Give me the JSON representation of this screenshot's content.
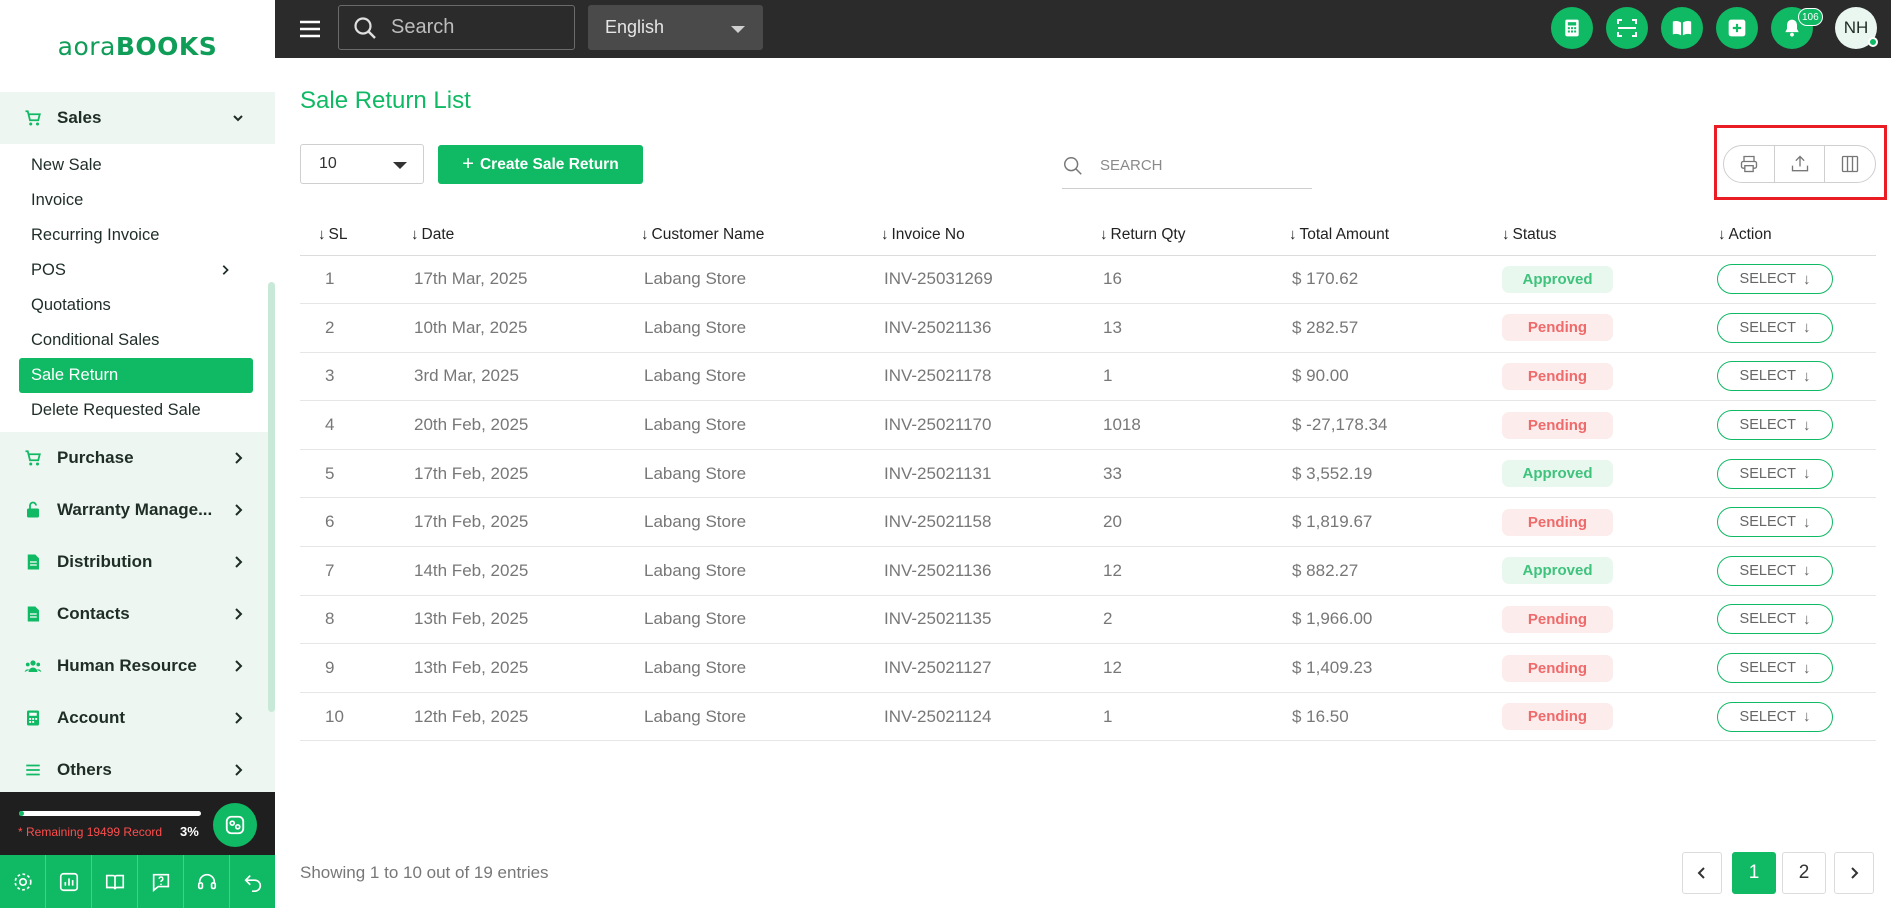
{
  "brand": {
    "logo_light": "aora",
    "logo_bold": "BOOKS"
  },
  "topbar": {
    "search_placeholder": "Search",
    "language": "English",
    "notification_count": "106",
    "avatar_initials": "NH"
  },
  "sidebar": {
    "sales": {
      "label": "Sales",
      "items": [
        "New Sale",
        "Invoice",
        "Recurring Invoice",
        "POS",
        "Quotations",
        "Conditional Sales",
        "Sale Return",
        "Delete Requested Sale"
      ],
      "active_item": "Sale Return"
    },
    "groups": [
      "Purchase",
      "Warranty Manage...",
      "Distribution",
      "Contacts",
      "Human Resource",
      "Account",
      "Others"
    ],
    "usage": {
      "text": "* Remaining 19499 Record",
      "percent": "3%",
      "fill_fraction": 0.03
    }
  },
  "page": {
    "title": "Sale Return List",
    "per_page": "10",
    "create_button": "Create Sale Return",
    "search_placeholder": "SEARCH"
  },
  "table": {
    "headers": [
      "SL",
      "Date",
      "Customer Name",
      "Invoice No",
      "Return Qty",
      "Total Amount",
      "Status",
      "Action"
    ],
    "rows": [
      {
        "sl": "1",
        "date": "17th Mar, 2025",
        "customer": "Labang Store",
        "invoice": "INV-25031269",
        "qty": "16",
        "amount": "$ 170.62",
        "status": "Approved",
        "action": "SELECT"
      },
      {
        "sl": "2",
        "date": "10th Mar, 2025",
        "customer": "Labang Store",
        "invoice": "INV-25021136",
        "qty": "13",
        "amount": "$ 282.57",
        "status": "Pending",
        "action": "SELECT"
      },
      {
        "sl": "3",
        "date": "3rd Mar, 2025",
        "customer": "Labang Store",
        "invoice": "INV-25021178",
        "qty": "1",
        "amount": "$ 90.00",
        "status": "Pending",
        "action": "SELECT"
      },
      {
        "sl": "4",
        "date": "20th Feb, 2025",
        "customer": "Labang Store",
        "invoice": "INV-25021170",
        "qty": "1018",
        "amount": "$ -27,178.34",
        "status": "Pending",
        "action": "SELECT"
      },
      {
        "sl": "5",
        "date": "17th Feb, 2025",
        "customer": "Labang Store",
        "invoice": "INV-25021131",
        "qty": "33",
        "amount": "$ 3,552.19",
        "status": "Approved",
        "action": "SELECT"
      },
      {
        "sl": "6",
        "date": "17th Feb, 2025",
        "customer": "Labang Store",
        "invoice": "INV-25021158",
        "qty": "20",
        "amount": "$ 1,819.67",
        "status": "Pending",
        "action": "SELECT"
      },
      {
        "sl": "7",
        "date": "14th Feb, 2025",
        "customer": "Labang Store",
        "invoice": "INV-25021136",
        "qty": "12",
        "amount": "$ 882.27",
        "status": "Approved",
        "action": "SELECT"
      },
      {
        "sl": "8",
        "date": "13th Feb, 2025",
        "customer": "Labang Store",
        "invoice": "INV-25021135",
        "qty": "2",
        "amount": "$ 1,966.00",
        "status": "Pending",
        "action": "SELECT"
      },
      {
        "sl": "9",
        "date": "13th Feb, 2025",
        "customer": "Labang Store",
        "invoice": "INV-25021127",
        "qty": "12",
        "amount": "$ 1,409.23",
        "status": "Pending",
        "action": "SELECT"
      },
      {
        "sl": "10",
        "date": "12th Feb, 2025",
        "customer": "Labang Store",
        "invoice": "INV-25021124",
        "qty": "1",
        "amount": "$ 16.50",
        "status": "Pending",
        "action": "SELECT"
      }
    ]
  },
  "footer": {
    "info": "Showing 1 to 10 out of 19 entries",
    "pages": [
      "1",
      "2"
    ],
    "current_page": "1"
  },
  "colors": {
    "accent": "#10b964",
    "topbar": "#2b2b2b",
    "approved": "#3ec27c",
    "pending": "#ef6a6a",
    "highlight": "#ea1c24"
  }
}
